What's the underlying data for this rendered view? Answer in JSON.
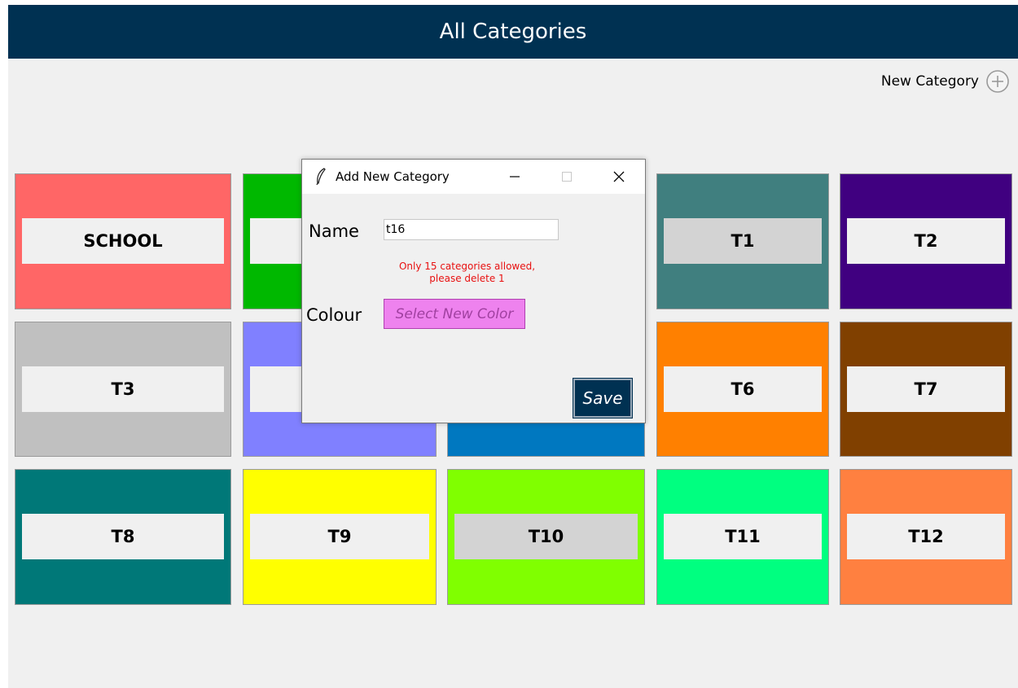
{
  "header": {
    "title": "All Categories"
  },
  "new_category": {
    "label": "New Category",
    "icon": "plus-circle-icon"
  },
  "categories": [
    {
      "label": "SCHOOL",
      "color": "#ff6666"
    },
    {
      "label": "",
      "color": "#00b800"
    },
    {
      "label": "",
      "color": "#ffffff"
    },
    {
      "label": "T1",
      "color": "#407f7f"
    },
    {
      "label": "T2",
      "color": "#400080"
    },
    {
      "label": "T3",
      "color": "#c0c0c0"
    },
    {
      "label": "",
      "color": "#8080ff"
    },
    {
      "label": "",
      "color": "#0078c0"
    },
    {
      "label": "T6",
      "color": "#ff8000"
    },
    {
      "label": "T7",
      "color": "#804000"
    },
    {
      "label": "T8",
      "color": "#007878"
    },
    {
      "label": "T9",
      "color": "#ffff00"
    },
    {
      "label": "T10",
      "color": "#80ff00"
    },
    {
      "label": "T11",
      "color": "#00ff80"
    },
    {
      "label": "T12",
      "color": "#ff8040"
    }
  ],
  "dialog": {
    "title": "Add New Category",
    "name_label": "Name",
    "name_value": "t16",
    "warning_line1": "Only 15 categories allowed,",
    "warning_line2": "please delete 1",
    "colour_label": "Colour",
    "color_button": "Select New Color",
    "color_button_color": "#ee82ee",
    "save_label": "Save"
  }
}
